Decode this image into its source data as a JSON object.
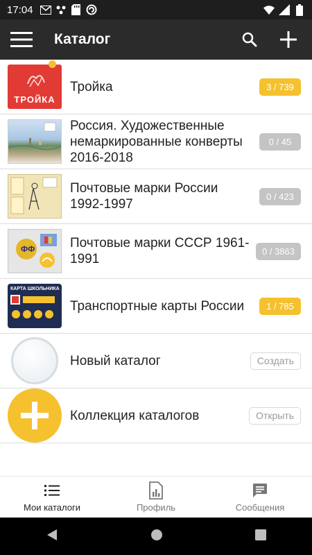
{
  "status_bar": {
    "time": "17:04"
  },
  "app_bar": {
    "title": "Каталог"
  },
  "catalogs": [
    {
      "title": "Тройка",
      "count": "3 / 739",
      "badge_style": "yellow",
      "thumb": "troika-card-image",
      "thumb_text": "ТРОЙКА"
    },
    {
      "title": "Россия. Художественные немаркированные конверты 2016-2018",
      "count": "0 / 45",
      "badge_style": "gray",
      "thumb": "envelope-image"
    },
    {
      "title": "Почтовые марки России 1992-1997",
      "count": "0 / 423",
      "badge_style": "gray",
      "thumb": "stamp-sheet-image"
    },
    {
      "title": "Почтовые марки СССР 1961-1991",
      "count": "0 / 3863",
      "badge_style": "gray",
      "thumb": "stamps-image"
    },
    {
      "title": "Транспортные карты России",
      "count": "1 / 785",
      "badge_style": "yellow",
      "thumb": "transport-card-image",
      "thumb_text": "КАРТА ШКОЛЬНИКА"
    }
  ],
  "new_catalog": {
    "title": "Новый каталог",
    "action": "Создать"
  },
  "catalog_collection": {
    "title": "Коллекция каталогов",
    "action": "Открыть"
  },
  "bottom_nav": [
    {
      "label": "Мои каталоги",
      "icon": "list-icon",
      "active": true
    },
    {
      "label": "Профиль",
      "icon": "profile-chart-icon",
      "active": false
    },
    {
      "label": "Сообщения",
      "icon": "message-icon",
      "active": false
    }
  ],
  "colors": {
    "accent": "#f5c12e",
    "app_bar": "#2b2b2b",
    "badge_gray": "#c4c4c4"
  }
}
